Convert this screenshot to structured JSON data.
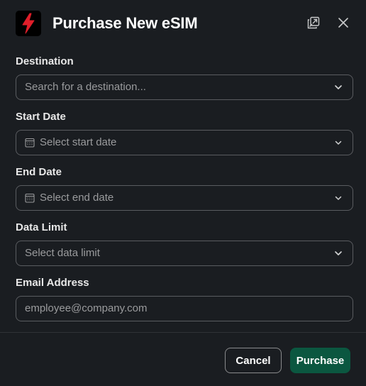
{
  "dialog": {
    "title": "Purchase New eSIM"
  },
  "form": {
    "destination": {
      "label": "Destination",
      "placeholder": "Search for a destination..."
    },
    "start_date": {
      "label": "Start Date",
      "placeholder": "Select start date"
    },
    "end_date": {
      "label": "End Date",
      "placeholder": "Select end date"
    },
    "data_limit": {
      "label": "Data Limit",
      "placeholder": "Select data limit"
    },
    "email": {
      "label": "Email Address",
      "placeholder": "employee@company.com"
    }
  },
  "footer": {
    "cancel_label": "Cancel",
    "purchase_label": "Purchase"
  },
  "colors": {
    "background": "#1a1d21",
    "primary_button": "#0b5740",
    "app_icon_bolt": "#e01e2a"
  },
  "icons": {
    "app": "lightning-bolt-icon",
    "popout": "popout-window-icon",
    "close": "close-icon",
    "dropdown": "chevron-down-icon",
    "calendar": "calendar-icon"
  }
}
